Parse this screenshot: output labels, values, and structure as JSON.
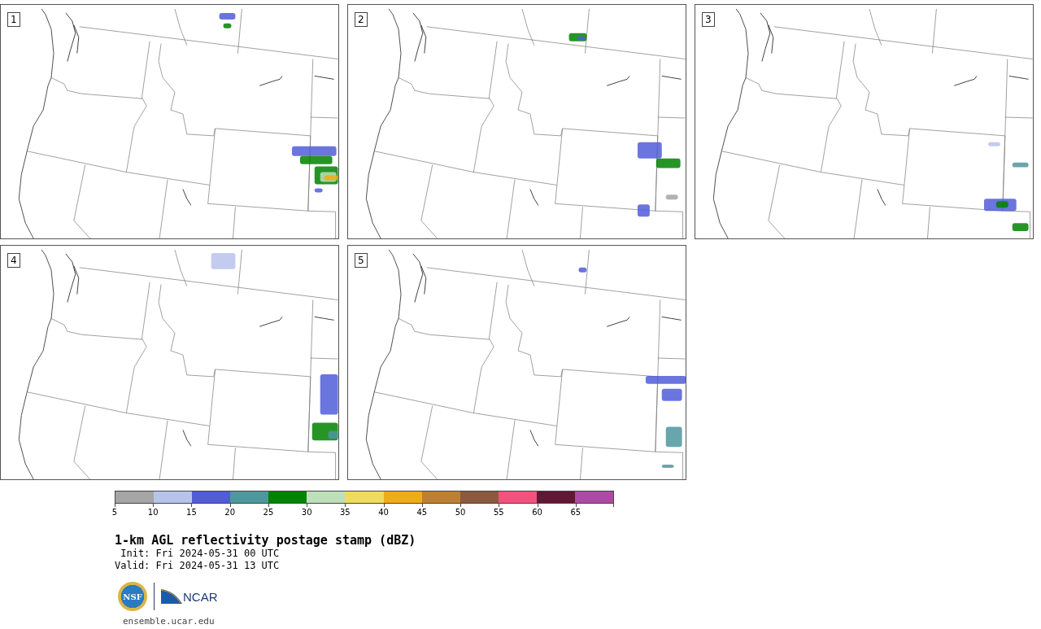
{
  "panels": [
    {
      "label": "1"
    },
    {
      "label": "2"
    },
    {
      "label": "3"
    },
    {
      "label": "4"
    },
    {
      "label": "5"
    }
  ],
  "colorbar": {
    "bins": [
      {
        "color": "#a5a5a5"
      },
      {
        "color": "#b8c3ec"
      },
      {
        "color": "#515dd8"
      },
      {
        "color": "#4e979d"
      },
      {
        "color": "#008300"
      },
      {
        "color": "#bddfba"
      },
      {
        "color": "#f0db5c"
      },
      {
        "color": "#efac17"
      },
      {
        "color": "#bd8032"
      },
      {
        "color": "#8b5a3e"
      },
      {
        "color": "#f4517f"
      },
      {
        "color": "#601834"
      },
      {
        "color": "#ae4aa4"
      }
    ],
    "ticks": [
      "5",
      "10",
      "15",
      "20",
      "25",
      "30",
      "35",
      "40",
      "45",
      "50",
      "55",
      "60",
      "65"
    ]
  },
  "title": "1-km AGL reflectivity postage stamp (dBZ)",
  "init": " Init: Fri 2024-05-31 00 UTC",
  "valid": "Valid: Fri 2024-05-31 13 UTC",
  "logo": {
    "nsf": "NSF",
    "ncar": "NCAR"
  },
  "url": "ensemble.ucar.edu"
}
